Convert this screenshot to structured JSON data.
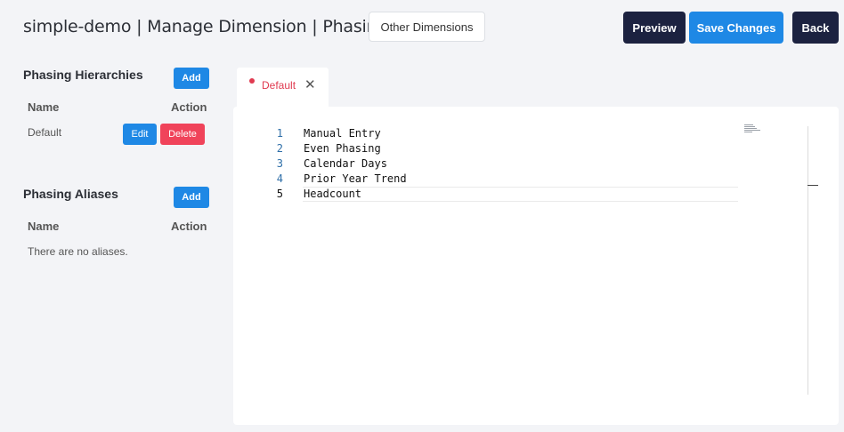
{
  "header": {
    "title": "simple-demo | Manage Dimension | Phasing",
    "other_dimensions_label": "Other Dimensions",
    "preview_label": "Preview",
    "save_label": "Save Changes",
    "back_label": "Back"
  },
  "hierarchies": {
    "title": "Phasing Hierarchies",
    "add_label": "Add",
    "col_name": "Name",
    "col_action": "Action",
    "rows": [
      {
        "name": "Default",
        "edit_label": "Edit",
        "delete_label": "Delete"
      }
    ]
  },
  "aliases": {
    "title": "Phasing Aliases",
    "add_label": "Add",
    "col_name": "Name",
    "col_action": "Action",
    "empty_text": "There are no aliases."
  },
  "tab": {
    "label": "Default"
  },
  "editor": {
    "lines": [
      {
        "num": "1",
        "text": "Manual Entry"
      },
      {
        "num": "2",
        "text": "Even Phasing"
      },
      {
        "num": "3",
        "text": "Calendar Days"
      },
      {
        "num": "4",
        "text": "Prior Year Trend"
      },
      {
        "num": "5",
        "text": "Headcount"
      }
    ]
  },
  "colors": {
    "primary": "#1e88e5",
    "dark": "#1c2240",
    "danger": "#f0435a",
    "tab_modified": "#e03a50"
  }
}
